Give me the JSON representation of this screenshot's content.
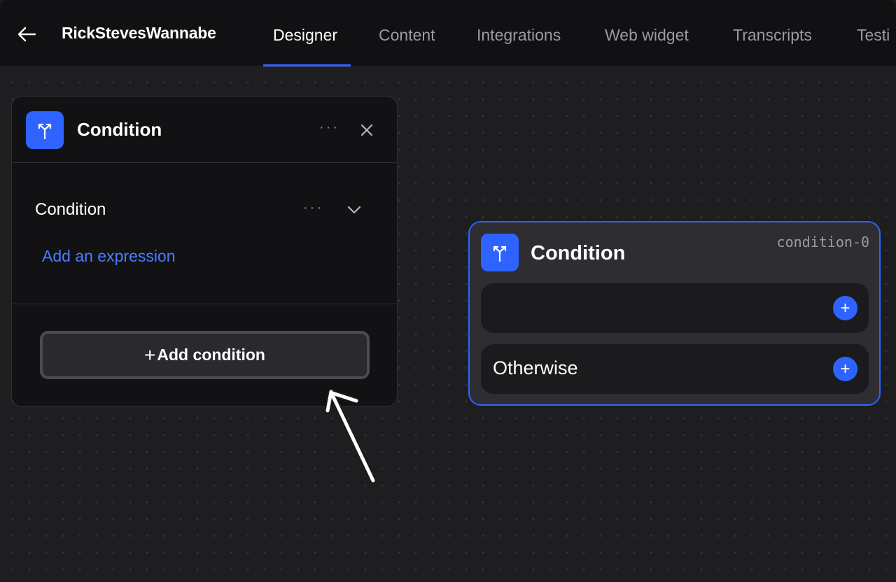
{
  "header": {
    "back_icon": "arrow-left-icon",
    "app_title": "RickStevesWannabe",
    "tabs": [
      {
        "label": "Designer",
        "active": true
      },
      {
        "label": "Content",
        "active": false
      },
      {
        "label": "Integrations",
        "active": false
      },
      {
        "label": "Web widget",
        "active": false
      },
      {
        "label": "Transcripts",
        "active": false
      },
      {
        "label": "Testi",
        "active": false
      }
    ]
  },
  "panel": {
    "icon": "split-branch-icon",
    "title": "Condition",
    "menu_label": "···",
    "close_icon": "close-icon",
    "section_label": "Condition",
    "section_menu_label": "···",
    "add_expression": "Add an expression",
    "add_condition_plus": "+",
    "add_condition": "Add condition"
  },
  "node": {
    "icon": "split-branch-icon",
    "title": "Condition",
    "id": "condition-0",
    "branches": [
      {
        "label": ""
      },
      {
        "label": "Otherwise"
      }
    ],
    "add_symbol": "+"
  },
  "annotation": {
    "icon": "annotation-arrow-icon"
  },
  "colors": {
    "accent": "#2f63ff",
    "link": "#4a7dff",
    "canvas": "#1e1e21",
    "topbar": "#111113"
  }
}
